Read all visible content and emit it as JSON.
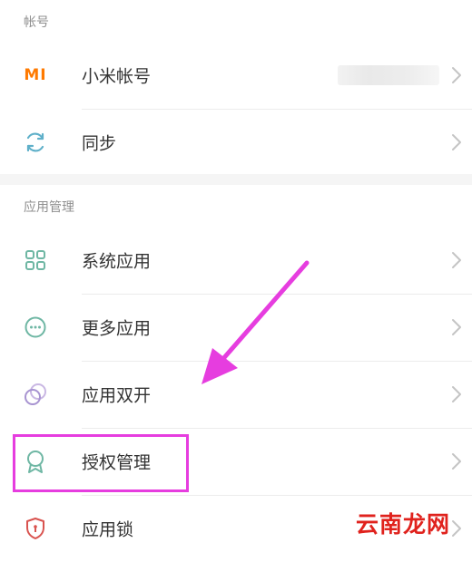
{
  "sections": {
    "account": {
      "header": "帐号",
      "items": [
        {
          "label": "小米帐号",
          "icon": "mi-logo-icon"
        },
        {
          "label": "同步",
          "icon": "sync-icon"
        }
      ]
    },
    "apps": {
      "header": "应用管理",
      "items": [
        {
          "label": "系统应用",
          "icon": "grid-icon"
        },
        {
          "label": "更多应用",
          "icon": "more-dots-icon"
        },
        {
          "label": "应用双开",
          "icon": "dual-circle-icon"
        },
        {
          "label": "授权管理",
          "icon": "award-badge-icon"
        },
        {
          "label": "应用锁",
          "icon": "shield-lock-icon"
        }
      ]
    }
  },
  "brand": {
    "mi_logo_text": "MI"
  },
  "watermark": {
    "text": "云南龙网"
  },
  "colors": {
    "mi_orange": "#ff7a00",
    "teal_icon": "#6fb7a4",
    "purple_icon": "#b6a4d8",
    "shield_red": "#d9534f",
    "highlight_magenta": "#e63ddf",
    "watermark_red": "#e0221d"
  }
}
